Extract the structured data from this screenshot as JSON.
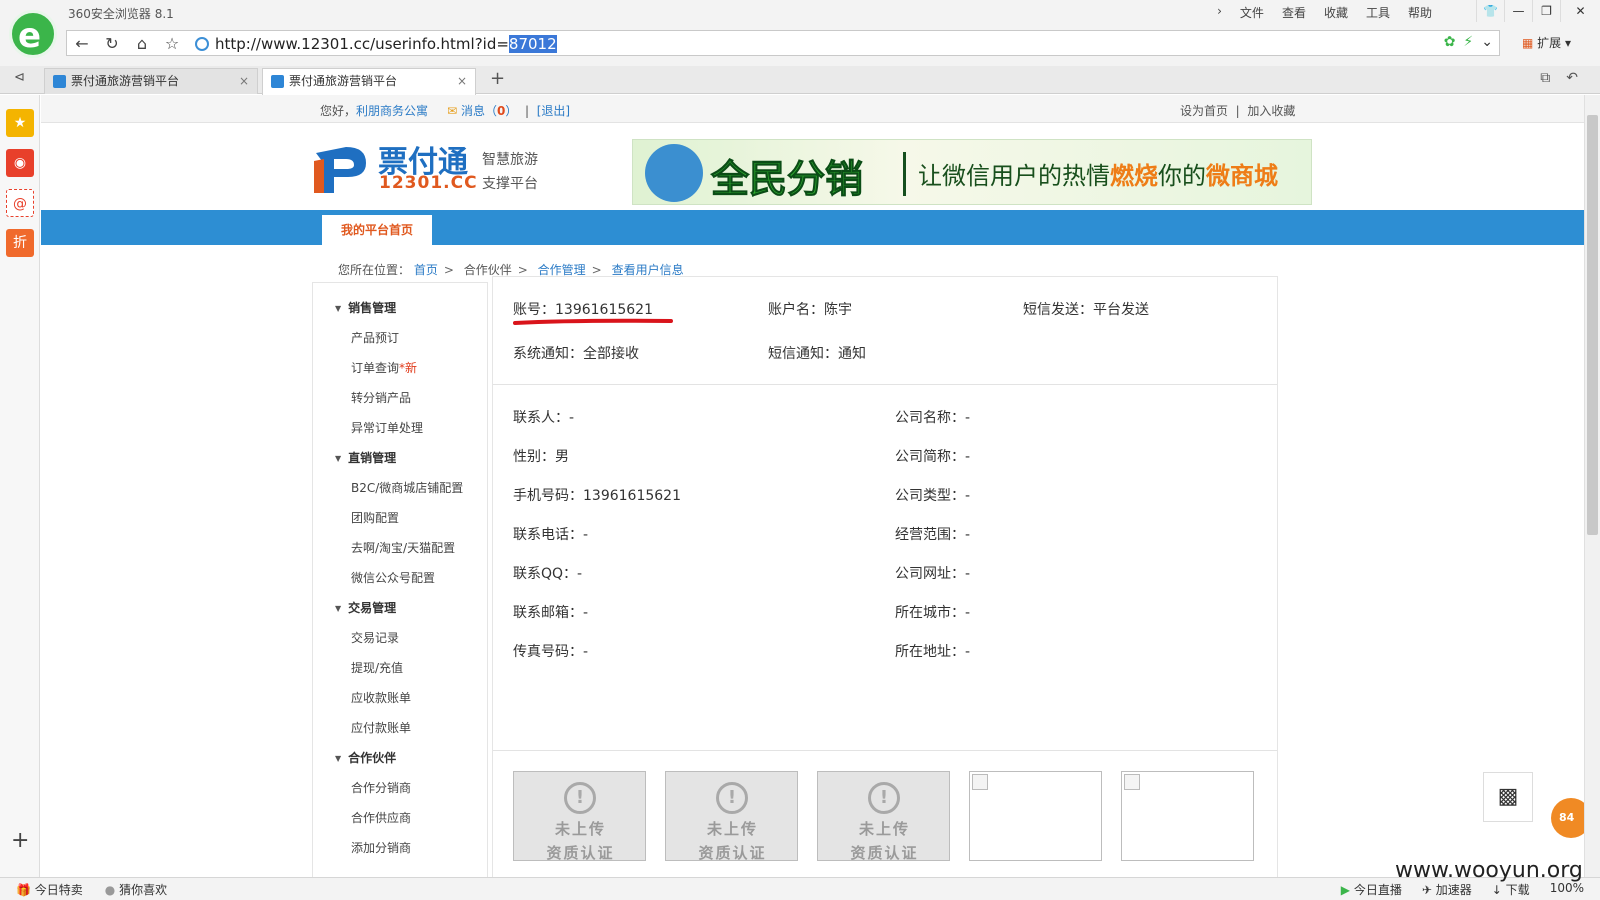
{
  "browser": {
    "app_title": "360安全浏览器 8.1",
    "menu": [
      "文件",
      "查看",
      "收藏",
      "工具",
      "帮助"
    ],
    "url_prefix": "http://www.12301.cc/userinfo.html?id=",
    "url_selected": "87012",
    "extensions_label": "扩展",
    "tabs": [
      {
        "label": "票付通旅游营销平台",
        "active": false
      },
      {
        "label": "票付通旅游营销平台",
        "active": true
      }
    ],
    "statusbar": {
      "left": [
        "今日特卖",
        "猜你喜欢"
      ],
      "right": [
        "今日直播",
        "加速器",
        "下载",
        "100%"
      ]
    },
    "watermark": "www.wooyun.org"
  },
  "top_strip": {
    "greeting": "您好，",
    "user": "利朋商务公寓",
    "messages_label": "消息",
    "messages_count": "0",
    "logout": "[退出]",
    "set_home": "设为首页",
    "add_fav": "加入收藏"
  },
  "brand": {
    "name_cn": "票付通",
    "domain": "12301.CC",
    "slogan1": "智慧旅游",
    "slogan2": "支撑平台"
  },
  "banner": {
    "headline": "全民分销",
    "text_a": "让微信用户的热情",
    "text_hot1": "燃烧",
    "text_b": "你的",
    "text_hot2": "微商城"
  },
  "nav": {
    "active_tab": "我的平台首页"
  },
  "breadcrumb": {
    "prefix": "您所在位置：",
    "items": [
      "首页",
      "合作伙伴",
      "合作管理",
      "查看用户信息"
    ]
  },
  "side_menu": [
    {
      "group": "销售管理",
      "items": [
        "产品预订",
        "订单查询",
        "转分销产品",
        "异常订单处理"
      ],
      "badge": "*新"
    },
    {
      "group": "直销管理",
      "items": [
        "B2C/微商城店铺配置",
        "团购配置",
        "去啊/淘宝/天猫配置",
        "微信公众号配置"
      ]
    },
    {
      "group": "交易管理",
      "items": [
        "交易记录",
        "提现/充值",
        "应收款账单",
        "应付款账单"
      ]
    },
    {
      "group": "合作伙伴",
      "items": [
        "合作分销商",
        "合作供应商",
        "添加分销商"
      ]
    }
  ],
  "account": {
    "account_no": "账号：13961615621",
    "account_name": "账户名：陈宇",
    "sms_send": "短信发送：平台发送",
    "sys_notice": "系统通知：全部接收",
    "sms_notice": "短信通知：通知"
  },
  "contact": {
    "left": [
      "联系人：-",
      "性别：男",
      "手机号码：13961615621",
      "联系电话：-",
      "联系QQ：-",
      "联系邮箱：-",
      "传真号码：-"
    ],
    "right": [
      "公司名称：-",
      "公司简称：-",
      "公司类型：-",
      "经营范围：-",
      "公司网址：-",
      "所在城市：-",
      "所在地址：-"
    ]
  },
  "certificates": {
    "placeholder_line1": "未上传",
    "placeholder_line2": "资质认证",
    "count_placeholder": 3,
    "count_broken": 2
  },
  "float_badge": "84",
  "colors": {
    "nav_blue": "#2d8ed3",
    "accent_orange": "#e0591f",
    "link_blue": "#2b7bc6",
    "underline_red": "#d9141b"
  }
}
